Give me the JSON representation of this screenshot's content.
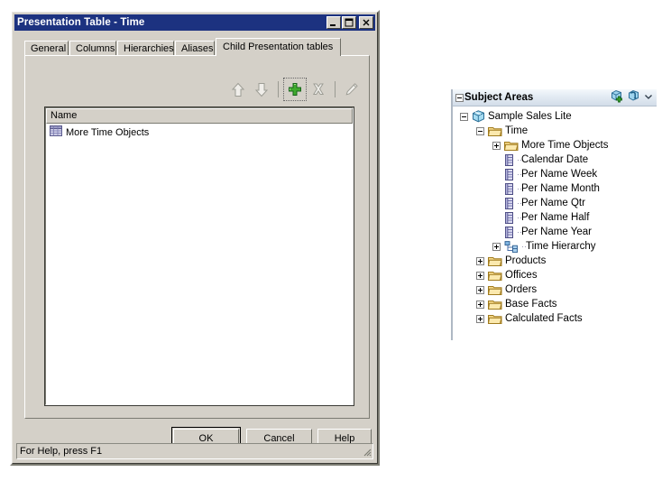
{
  "dialog": {
    "title": "Presentation Table - Time",
    "window_buttons": [
      {
        "name": "minimize",
        "label": "_"
      },
      {
        "name": "maximize",
        "label": "□"
      },
      {
        "name": "close",
        "label": "✕"
      }
    ],
    "tabs": [
      {
        "label": "General",
        "active": false
      },
      {
        "label": "Columns",
        "active": false
      },
      {
        "label": "Hierarchies",
        "active": false
      },
      {
        "label": "Aliases",
        "active": false
      },
      {
        "label": "Child Presentation tables",
        "active": true
      }
    ],
    "toolbar": [
      {
        "name": "move-up-button",
        "icon": "arrow-up-icon",
        "enabled": false
      },
      {
        "name": "move-down-button",
        "icon": "arrow-down-icon",
        "enabled": false
      },
      {
        "name": "add-button",
        "icon": "green-plus-icon",
        "enabled": true
      },
      {
        "name": "delete-button",
        "icon": "x-cross-icon",
        "enabled": false
      },
      {
        "name": "edit-button",
        "icon": "pencil-icon",
        "enabled": false
      }
    ],
    "list": {
      "column_header": "Name",
      "rows": [
        {
          "name": "More Time Objects",
          "icon": "presentation-table-icon"
        }
      ]
    },
    "buttons": {
      "ok": "OK",
      "cancel": "Cancel",
      "help": "Help"
    },
    "status": "For Help, press F1"
  },
  "subject_areas": {
    "title": "Subject Areas",
    "header_icons": [
      {
        "name": "add-subject-area-icon"
      },
      {
        "name": "refresh-subject-area-icon"
      },
      {
        "name": "chevron-down-icon"
      }
    ],
    "tree": [
      {
        "label": "Sample Sales Lite",
        "icon": "subject-area-cube-icon",
        "indent": 0,
        "state": "expanded",
        "dots": false
      },
      {
        "label": "Time",
        "icon": "folder-icon",
        "indent": 1,
        "state": "expanded",
        "dots": false
      },
      {
        "label": "More Time Objects",
        "icon": "folder-icon",
        "indent": 2,
        "state": "collapsed",
        "dots": false
      },
      {
        "label": "Calendar Date",
        "icon": "column-icon",
        "indent": 2,
        "state": "leaf",
        "dots": true
      },
      {
        "label": "Per Name Week",
        "icon": "column-icon",
        "indent": 2,
        "state": "leaf",
        "dots": true
      },
      {
        "label": "Per Name Month",
        "icon": "column-icon",
        "indent": 2,
        "state": "leaf",
        "dots": true
      },
      {
        "label": "Per Name Qtr",
        "icon": "column-icon",
        "indent": 2,
        "state": "leaf",
        "dots": true
      },
      {
        "label": "Per Name Half",
        "icon": "column-icon",
        "indent": 2,
        "state": "leaf",
        "dots": true
      },
      {
        "label": "Per Name Year",
        "icon": "column-icon",
        "indent": 2,
        "state": "leaf",
        "dots": true
      },
      {
        "label": "Time Hierarchy",
        "icon": "hierarchy-icon",
        "indent": 2,
        "state": "collapsed",
        "dots": true
      },
      {
        "label": "Products",
        "icon": "folder-icon",
        "indent": 1,
        "state": "collapsed",
        "dots": false
      },
      {
        "label": "Offices",
        "icon": "folder-icon",
        "indent": 1,
        "state": "collapsed",
        "dots": false
      },
      {
        "label": "Orders",
        "icon": "folder-icon",
        "indent": 1,
        "state": "collapsed",
        "dots": false
      },
      {
        "label": "Base Facts",
        "icon": "folder-icon",
        "indent": 1,
        "state": "collapsed",
        "dots": false
      },
      {
        "label": "Calculated Facts",
        "icon": "folder-icon",
        "indent": 1,
        "state": "collapsed",
        "dots": false
      }
    ]
  },
  "colors": {
    "titlebar": "#1c3280",
    "dialog_face": "#d4d0c8",
    "panel_header": "#e3ebf3",
    "accent_green": "#2aa02a",
    "folder": "#f5d06a"
  }
}
